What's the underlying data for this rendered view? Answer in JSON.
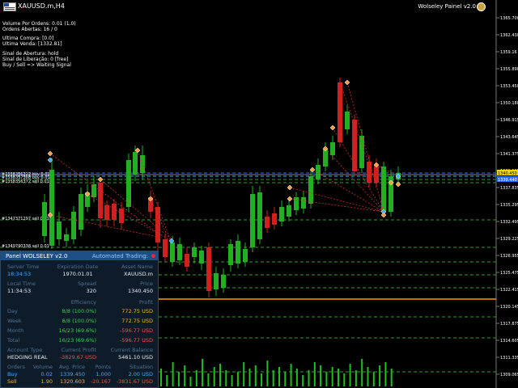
{
  "window": {
    "symbol_title": "XAUUSD.m,H4",
    "ea_label": "Wolseley Painel v2.0"
  },
  "info_text": {
    "volume": "Volume Por Ordens: 0.01 (1.0)",
    "orders_open": "Ordens Abertas: 16 / 0",
    "last_buy": "Ultima Compra: [0.0]",
    "last_sell": "Ultima Venda: [1332.81]",
    "open_signal": "Sinal de Abertura: hold",
    "release_signal": "Sinal de Liberação: 0 [free]",
    "buy_sell": "Buy / Sell => Waiting Signal"
  },
  "order_labels": [
    "#1358356222 buy 0.01",
    "#1358357388 buy 0.01",
    "#1358356372 sell 0.01",
    "#1347371297 sell 0.01",
    "#1349790338 sell 0.01"
  ],
  "price_axis": {
    "ticks": [
      "1365.700",
      "1362.430",
      "1359.16",
      "1355.890",
      "1353.450",
      "1350.180",
      "1346.915",
      "1343.645",
      "1341.375",
      "1339.105",
      "1337.835",
      "1335.295",
      "1332.495",
      "1329.225",
      "1326.955",
      "1325.475",
      "1322.415",
      "1320.145",
      "1317.875",
      "1314.605",
      "1311.335",
      "1309.065"
    ],
    "bid_label": "1340.450",
    "ask_label": "1339.440"
  },
  "panel": {
    "title": "Panel WOLSELEY v2.0",
    "mode": "Automated Trading:",
    "headers1": [
      "Server Time",
      "Expiration Date",
      "Asset Name"
    ],
    "values1": [
      "18:34:53",
      "1970.01.01",
      "XAUUSD.m"
    ],
    "headers2": [
      "Local Time",
      "Spread",
      "Price"
    ],
    "values2": [
      "11:34:53",
      "320",
      "1340.450"
    ],
    "efficiency_header": [
      "Efficiency",
      "Profit"
    ],
    "stats": [
      {
        "label": "Day",
        "eff": "8/8 (100.0%)",
        "profit": "772.75 USD"
      },
      {
        "label": "Week",
        "eff": "8/8 (100.0%)",
        "profit": "772.75 USD"
      },
      {
        "label": "Month",
        "eff": "16/23 (69.6%)",
        "profit": "-596.77 USD"
      },
      {
        "label": "Total",
        "eff": "16/23 (69.6%)",
        "profit": "-596.77 USD"
      }
    ],
    "account_headers": [
      "Account Type",
      "Current Profit",
      "Current Balance"
    ],
    "account_values": [
      "HEDGING REAL",
      "-3829.67 USD",
      "5461.10 USD"
    ],
    "orders_headers": [
      "Orders",
      "Volume",
      "Avg. Price",
      "Points",
      "Situation"
    ],
    "orders": [
      {
        "side": "Buy",
        "volume": "0.02",
        "avg": "1339.450",
        "points": "1.000",
        "situation": "2.00 USD"
      },
      {
        "side": "Sell",
        "volume": "1.90",
        "avg": "1320.603",
        "points": "-20.167",
        "situation": "-3831.67 USD"
      }
    ]
  },
  "colors": {
    "bull": "#22b022",
    "bear": "#d02020",
    "bid_line": "#ff9800",
    "dashed_green": "#2f9e2f",
    "background": "#000000"
  }
}
